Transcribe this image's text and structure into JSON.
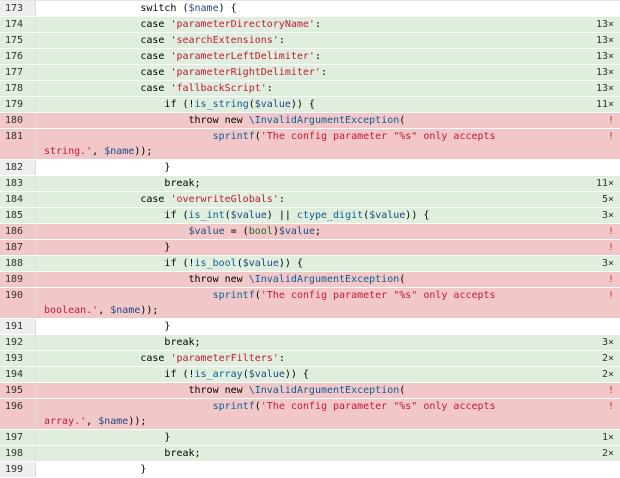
{
  "rows": [
    {
      "line": "173",
      "code": "                switch ($name) {",
      "state": "neutral",
      "hits": ""
    },
    {
      "line": "174",
      "code": "                case 'parameterDirectoryName':",
      "state": "covered",
      "hits": "13×"
    },
    {
      "line": "175",
      "code": "                case 'searchExtensions':",
      "state": "covered",
      "hits": "13×"
    },
    {
      "line": "176",
      "code": "                case 'parameterLeftDelimiter':",
      "state": "covered",
      "hits": "13×"
    },
    {
      "line": "177",
      "code": "                case 'parameterRightDelimiter':",
      "state": "covered",
      "hits": "13×"
    },
    {
      "line": "178",
      "code": "                case 'fallbackScript':",
      "state": "covered",
      "hits": "13×"
    },
    {
      "line": "179",
      "code": "                    if (!is_string($value)) {",
      "state": "covered",
      "hits": "11×"
    },
    {
      "line": "180",
      "code": "                        throw new \\InvalidArgumentException(",
      "state": "uncovered",
      "hits": "!"
    },
    {
      "line": "181",
      "code": "                            sprintf('The config parameter \"%s\" only accepts\nstring.', $name));",
      "state": "uncovered",
      "hits": "!",
      "wrapped": true
    },
    {
      "line": "182",
      "code": "                    }",
      "state": "neutral",
      "hits": ""
    },
    {
      "line": "183",
      "code": "                    break;",
      "state": "covered",
      "hits": "11×"
    },
    {
      "line": "184",
      "code": "                case 'overwriteGlobals':",
      "state": "covered",
      "hits": "5×"
    },
    {
      "line": "185",
      "code": "                    if (is_int($value) || ctype_digit($value)) {",
      "state": "covered",
      "hits": "3×"
    },
    {
      "line": "186",
      "code": "                        $value = (bool)$value;",
      "state": "uncovered",
      "hits": "!"
    },
    {
      "line": "187",
      "code": "                    }",
      "state": "uncovered",
      "hits": "!"
    },
    {
      "line": "188",
      "code": "                    if (!is_bool($value)) {",
      "state": "covered",
      "hits": "3×"
    },
    {
      "line": "189",
      "code": "                        throw new \\InvalidArgumentException(",
      "state": "uncovered",
      "hits": "!"
    },
    {
      "line": "190",
      "code": "                            sprintf('The config parameter \"%s\" only accepts\nboolean.', $name));",
      "state": "uncovered",
      "hits": "!",
      "wrapped": true
    },
    {
      "line": "191",
      "code": "                    }",
      "state": "neutral",
      "hits": ""
    },
    {
      "line": "192",
      "code": "                    break;",
      "state": "covered",
      "hits": "3×"
    },
    {
      "line": "193",
      "code": "                case 'parameterFilters':",
      "state": "covered",
      "hits": "2×"
    },
    {
      "line": "194",
      "code": "                    if (!is_array($value)) {",
      "state": "covered",
      "hits": "2×"
    },
    {
      "line": "195",
      "code": "                        throw new \\InvalidArgumentException(",
      "state": "uncovered",
      "hits": "!"
    },
    {
      "line": "196",
      "code": "                            sprintf('The config parameter \"%s\" only accepts\narray.', $name));",
      "state": "uncovered",
      "hits": "!",
      "wrapped": true
    },
    {
      "line": "197",
      "code": "                    }",
      "state": "covered",
      "hits": "1×"
    },
    {
      "line": "198",
      "code": "                    break;",
      "state": "covered",
      "hits": "2×"
    },
    {
      "line": "199",
      "code": "                }",
      "state": "neutral",
      "hits": ""
    }
  ],
  "colors": {
    "covered": "#dfeedd",
    "uncovered": "#f2c7c7",
    "neutral": "#ffffff"
  }
}
